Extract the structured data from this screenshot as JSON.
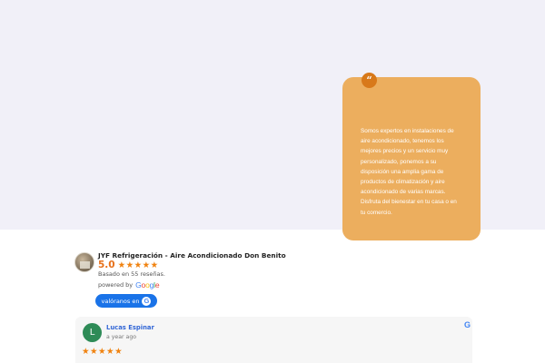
{
  "quote": {
    "badge": "“",
    "text": "Somos expertos en instalaciones de aire acondicionado, tenemos los mejores precios y un servicio muy personalizado, ponemos a su disposición una amplia gama de productos de climatización y aire acondicionado de varias marcas. Disfruta del bienestar en tu casa o en tu comercio."
  },
  "business": {
    "name": "JYF Refrigeración - Aire Acondicionado Don Benito",
    "score": "5.0",
    "stars": "★★★★★",
    "based_on": "Basado en 55 reseñas.",
    "powered_by": "powered by",
    "google_logo_letters": [
      "G",
      "o",
      "o",
      "g",
      "l",
      "e"
    ]
  },
  "rate_button": {
    "label": "valóranos en",
    "icon": "google-g-icon"
  },
  "review": {
    "avatar_letter": "L",
    "avatar_color": "#2e8b57",
    "author": "Lucas Espinar",
    "date": "a year ago",
    "stars": "★★★★★",
    "source_icon": "google-g-icon"
  },
  "colors": {
    "accent_orange": "#ecae5e",
    "badge_orange": "#d8791a",
    "star_orange": "#f0820f",
    "google_blue": "#1a73e8"
  }
}
